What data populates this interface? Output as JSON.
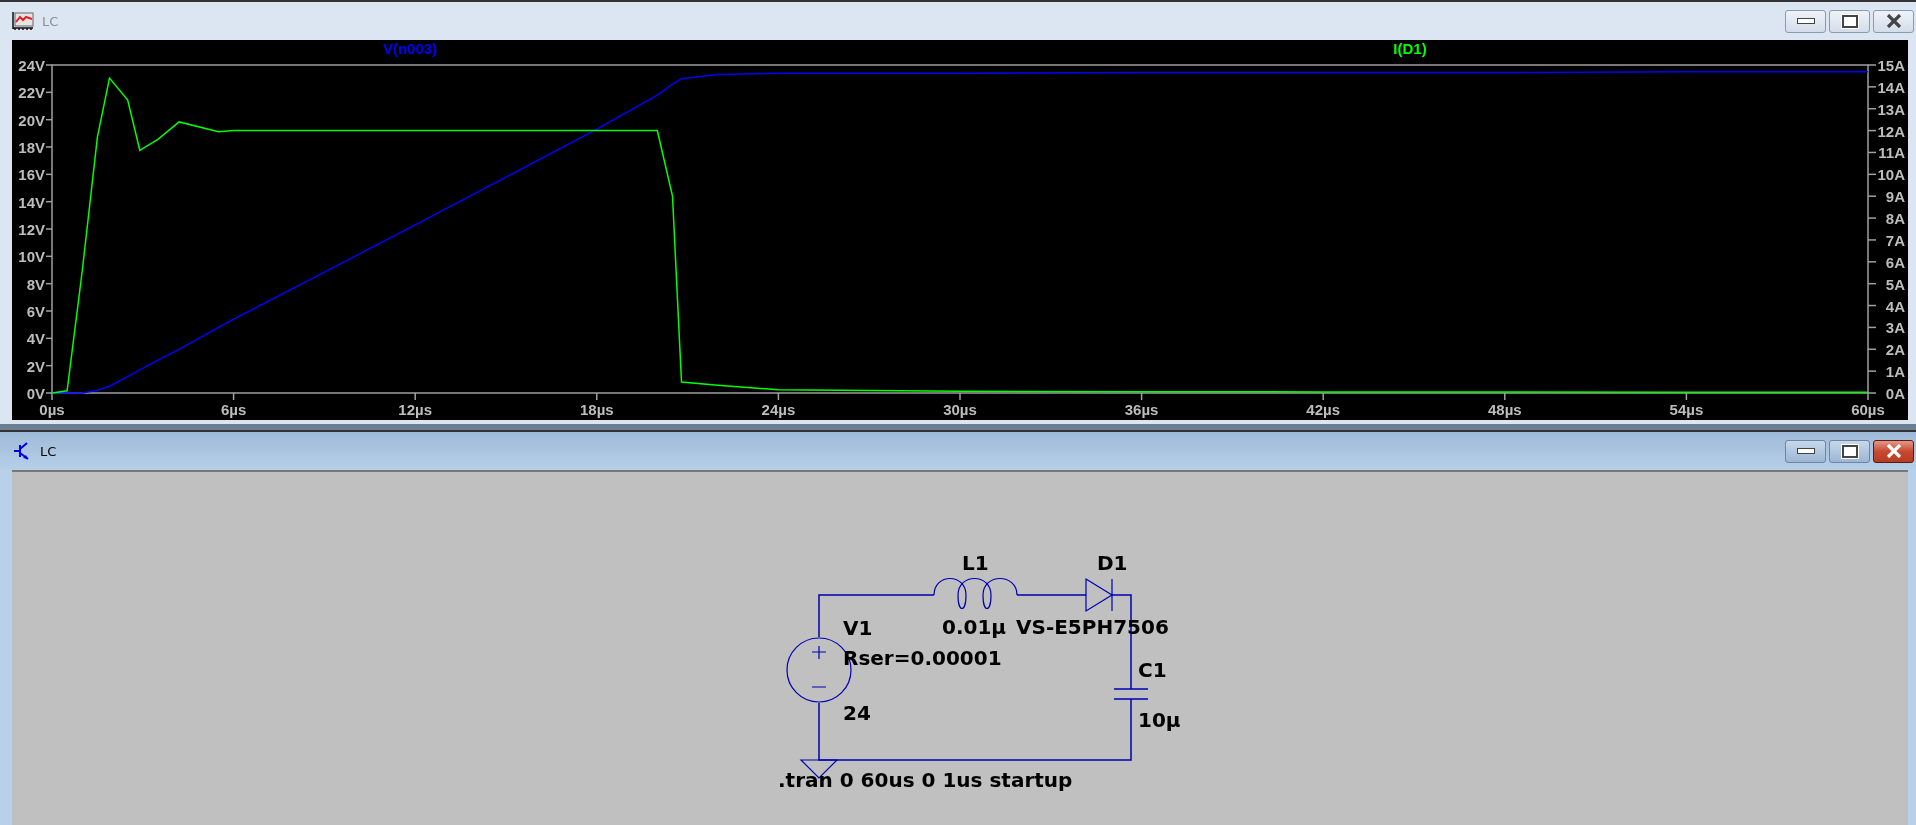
{
  "windows": [
    {
      "kind": "waveform",
      "title": "LC",
      "active": false,
      "plot": {
        "chart_data": {
          "type": "line",
          "x": [
            0,
            0.5,
            1,
            1.5,
            1.9,
            2.5,
            2.9,
            3.5,
            4.2,
            5.5,
            6,
            8,
            10,
            12,
            15,
            18,
            20,
            20.5,
            20.8,
            22,
            24,
            30,
            36,
            42,
            48,
            54,
            60
          ],
          "series": [
            {
              "name": "V(n003)",
              "color": "#0000ff",
              "values": [
                0,
                0,
                0,
                0.2,
                0.5,
                1.2,
                1.7,
                2.4,
                3.2,
                4.8,
                5.4,
                7.7,
                10,
                12.3,
                15.8,
                19.3,
                21.8,
                22.6,
                23,
                23.3,
                23.4,
                23.4,
                23.45,
                23.45,
                23.45,
                23.5,
                23.5
              ]
            },
            {
              "name": "I(D1)",
              "color": "#00ff00",
              "axis": "y2",
              "values": [
                0,
                0.1,
                5.6,
                11.7,
                14.4,
                13.4,
                11.1,
                11.6,
                12.4,
                11.95,
                12,
                12,
                12,
                12,
                12,
                12,
                12,
                9,
                0.5,
                0.35,
                0.15,
                0.08,
                0.06,
                0.05,
                0.05,
                0.03,
                0.03
              ]
            }
          ],
          "xlim": [
            0,
            60
          ],
          "ylim": [
            0,
            24
          ],
          "xticks": [
            {
              "value": 0,
              "label": "0µs"
            },
            {
              "value": 6,
              "label": "6µs"
            },
            {
              "value": 12,
              "label": "12µs"
            },
            {
              "value": 18,
              "label": "18µs"
            },
            {
              "value": 24,
              "label": "24µs"
            },
            {
              "value": 30,
              "label": "30µs"
            },
            {
              "value": 36,
              "label": "36µs"
            },
            {
              "value": 42,
              "label": "42µs"
            },
            {
              "value": 48,
              "label": "48µs"
            },
            {
              "value": 54,
              "label": "54µs"
            },
            {
              "value": 60,
              "label": "60µs"
            }
          ],
          "yticks": [
            {
              "value": 0,
              "label": "0V"
            },
            {
              "value": 2,
              "label": "2V"
            },
            {
              "value": 4,
              "label": "4V"
            },
            {
              "value": 6,
              "label": "6V"
            },
            {
              "value": 8,
              "label": "8V"
            },
            {
              "value": 10,
              "label": "10V"
            },
            {
              "value": 12,
              "label": "12V"
            },
            {
              "value": 14,
              "label": "14V"
            },
            {
              "value": 16,
              "label": "16V"
            },
            {
              "value": 18,
              "label": "18V"
            },
            {
              "value": 20,
              "label": "20V"
            },
            {
              "value": 22,
              "label": "22V"
            },
            {
              "value": 24,
              "label": "24V"
            }
          ],
          "y2lim": [
            0,
            15
          ],
          "y2ticks": [
            {
              "value": 0,
              "label": "0A"
            },
            {
              "value": 1,
              "label": "1A"
            },
            {
              "value": 2,
              "label": "2A"
            },
            {
              "value": 3,
              "label": "3A"
            },
            {
              "value": 4,
              "label": "4A"
            },
            {
              "value": 5,
              "label": "5A"
            },
            {
              "value": 6,
              "label": "6A"
            },
            {
              "value": 7,
              "label": "7A"
            },
            {
              "value": 8,
              "label": "8A"
            },
            {
              "value": 9,
              "label": "9A"
            },
            {
              "value": 10,
              "label": "10A"
            },
            {
              "value": 11,
              "label": "11A"
            },
            {
              "value": 12,
              "label": "12A"
            },
            {
              "value": 13,
              "label": "13A"
            },
            {
              "value": 14,
              "label": "14A"
            },
            {
              "value": 15,
              "label": "15A"
            }
          ]
        }
      }
    },
    {
      "kind": "schematic",
      "title": "LC",
      "active": true,
      "components": [
        {
          "kind": "voltage_source",
          "name": "V1",
          "values": [
            "Rser=0.00001",
            "24"
          ]
        },
        {
          "kind": "inductor",
          "name": "L1",
          "values": [
            "0.01µ"
          ]
        },
        {
          "kind": "diode",
          "name": "D1",
          "values": [
            "VS-E5PH7506"
          ]
        },
        {
          "kind": "capacitor",
          "name": "C1",
          "values": [
            "10µ"
          ]
        }
      ],
      "directive": ".tran 0 60us 0 1us startup"
    }
  ]
}
